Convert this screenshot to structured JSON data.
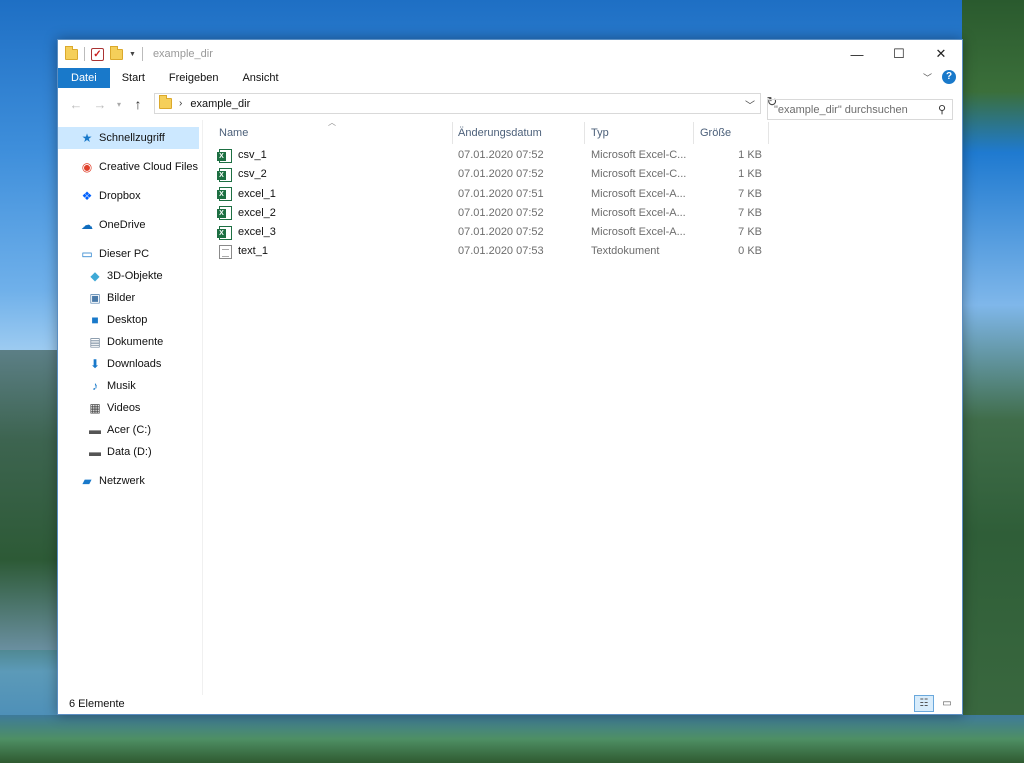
{
  "window": {
    "title": "example_dir",
    "controls": {
      "minimize": "—",
      "maximize": "☐",
      "close": "✕"
    }
  },
  "quick_access": {
    "properties_label": "✓",
    "dropdown": "▼"
  },
  "ribbon": {
    "tabs": [
      {
        "label": "Datei"
      },
      {
        "label": "Start"
      },
      {
        "label": "Freigeben"
      },
      {
        "label": "Ansicht"
      }
    ],
    "expand_icon": "﹀",
    "help_icon": "?"
  },
  "address": {
    "back": "←",
    "forward": "→",
    "recent": "▾",
    "up": "↑",
    "separator": "›",
    "path": "example_dir",
    "dropdown": "﹀",
    "refresh": "↻"
  },
  "search": {
    "placeholder": "\"example_dir\" durchsuchen",
    "icon": "⚲"
  },
  "navigation": [
    {
      "label": "Schnellzugriff",
      "icon": "star-icon",
      "glyph": "★",
      "color": "#1979ca",
      "level": 0,
      "selected": true
    },
    {
      "label": "Creative Cloud Files",
      "icon": "creative-cloud-folder-icon",
      "glyph": "◉",
      "color": "#e0402a",
      "level": 0
    },
    {
      "label": "Dropbox",
      "icon": "dropbox-icon",
      "glyph": "❖",
      "color": "#0061fe",
      "level": 0
    },
    {
      "label": "OneDrive",
      "icon": "onedrive-icon",
      "glyph": "☁",
      "color": "#0f6cbd",
      "level": 0
    },
    {
      "label": "Dieser PC",
      "icon": "computer-icon",
      "glyph": "▭",
      "color": "#1979ca",
      "level": 0
    },
    {
      "label": "3D-Objekte",
      "icon": "cube-icon",
      "glyph": "◆",
      "color": "#3fa9d6",
      "level": 1
    },
    {
      "label": "Bilder",
      "icon": "pictures-icon",
      "glyph": "▣",
      "color": "#4a7aa8",
      "level": 1
    },
    {
      "label": "Desktop",
      "icon": "desktop-icon",
      "glyph": "■",
      "color": "#1979ca",
      "level": 1
    },
    {
      "label": "Dokumente",
      "icon": "document-icon",
      "glyph": "▤",
      "color": "#6a7f95",
      "level": 1
    },
    {
      "label": "Downloads",
      "icon": "download-icon",
      "glyph": "⬇",
      "color": "#1979ca",
      "level": 1
    },
    {
      "label": "Musik",
      "icon": "music-icon",
      "glyph": "♪",
      "color": "#1979ca",
      "level": 1
    },
    {
      "label": "Videos",
      "icon": "video-icon",
      "glyph": "▦",
      "color": "#444444",
      "level": 1
    },
    {
      "label": "Acer (C:)",
      "icon": "system-drive-icon",
      "glyph": "▬",
      "color": "#555555",
      "level": 1
    },
    {
      "label": "Data (D:)",
      "icon": "drive-icon",
      "glyph": "▬",
      "color": "#555555",
      "level": 1
    },
    {
      "label": "Netzwerk",
      "icon": "network-icon",
      "glyph": "▰",
      "color": "#1979ca",
      "level": 0
    }
  ],
  "columns": {
    "name": "Name",
    "date": "Änderungsdatum",
    "type": "Typ",
    "size": "Größe",
    "sort_indicator": "︿"
  },
  "files": [
    {
      "name": "csv_1",
      "date": "07.01.2020 07:52",
      "type": "Microsoft Excel-C...",
      "size": "1 KB",
      "icon": "excel-file-icon"
    },
    {
      "name": "csv_2",
      "date": "07.01.2020 07:52",
      "type": "Microsoft Excel-C...",
      "size": "1 KB",
      "icon": "excel-file-icon"
    },
    {
      "name": "excel_1",
      "date": "07.01.2020 07:51",
      "type": "Microsoft Excel-A...",
      "size": "7 KB",
      "icon": "excel-file-icon"
    },
    {
      "name": "excel_2",
      "date": "07.01.2020 07:52",
      "type": "Microsoft Excel-A...",
      "size": "7 KB",
      "icon": "excel-file-icon"
    },
    {
      "name": "excel_3",
      "date": "07.01.2020 07:52",
      "type": "Microsoft Excel-A...",
      "size": "7 KB",
      "icon": "excel-file-icon"
    },
    {
      "name": "text_1",
      "date": "07.01.2020 07:53",
      "type": "Textdokument",
      "size": "0 KB",
      "icon": "text-file-icon"
    }
  ],
  "status": {
    "count": "6 Elemente",
    "details_view": "☷",
    "tiles_view": "▭"
  },
  "colors": {
    "accent": "#1979ca",
    "selection": "#cce8ff",
    "header_text": "#4c607a",
    "muted_text": "#6d6d6d"
  }
}
